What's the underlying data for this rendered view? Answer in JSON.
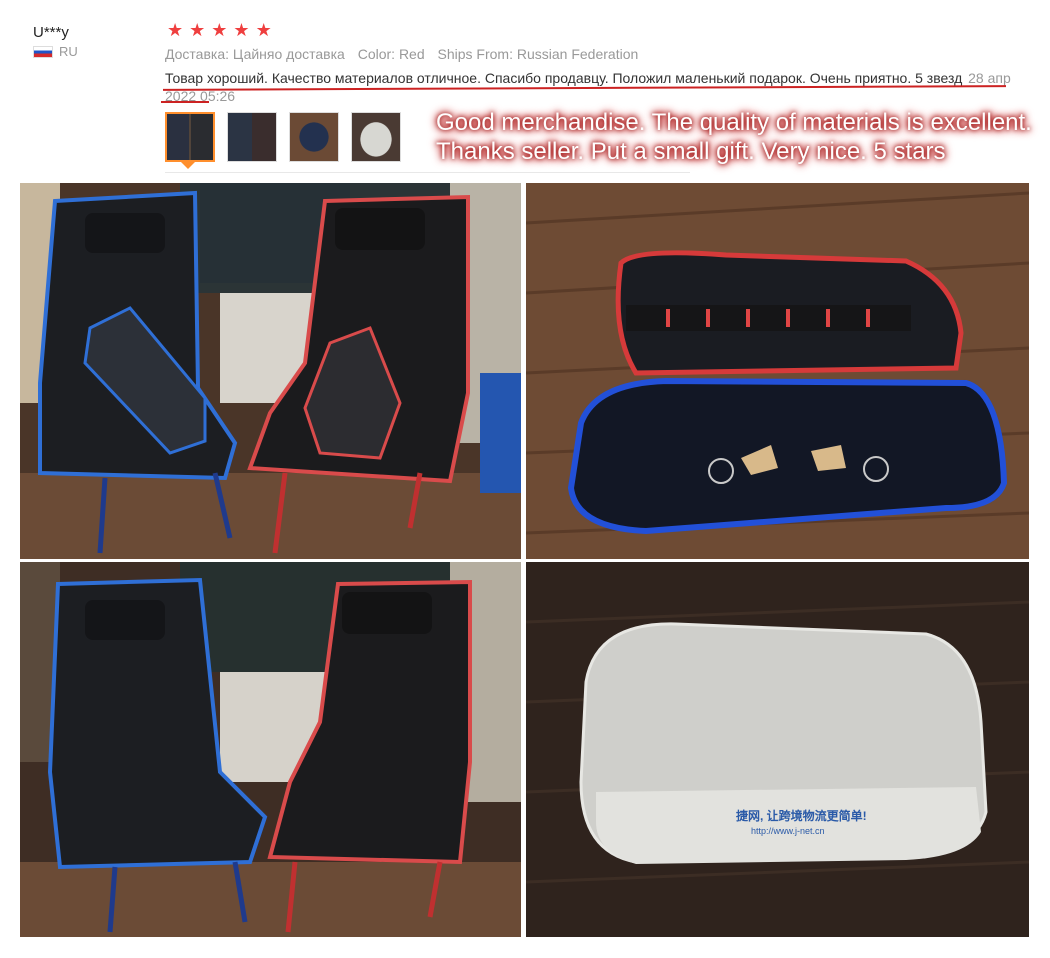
{
  "reviewer": {
    "name": "U***y",
    "country": "RU"
  },
  "rating": {
    "stars": 5,
    "star_color": "#ef3f3f"
  },
  "meta": {
    "delivery": "Доставка: Цайняо доставка",
    "color": "Color: Red",
    "ships_from": "Ships From: Russian Federation"
  },
  "review": {
    "text": "Товар хороший. Качество материалов отличное. Спасибо продавцу. Положил маленький подарок. Очень приятно. 5 звезд",
    "date": "28 апр 2022 05:26"
  },
  "translation": {
    "line1": "Good merchandise. The quality of materials is excellent.",
    "line2": "Thanks seller. Put a small gift. Very nice. 5 stars"
  },
  "barcode": "",
  "photos": {
    "bag_print": "捷网, 让跨境物流更简单!",
    "bag_url": "http://www.j-net.cn"
  },
  "colors": {
    "accent": "#ff8f2d",
    "annotation": "#cc2222"
  }
}
